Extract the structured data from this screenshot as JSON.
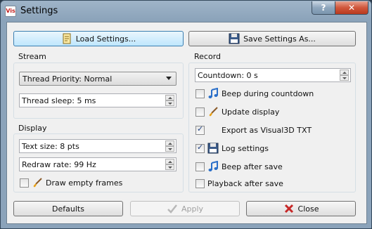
{
  "window": {
    "title": "Settings",
    "app_icon_text": "Vis"
  },
  "titlebar": {
    "help_label": "?",
    "close_label": "✕"
  },
  "toolbar": {
    "load_label": "Load Settings...",
    "save_as_label": "Save Settings As..."
  },
  "stream": {
    "heading": "Stream",
    "thread_priority": "Thread Priority: Normal",
    "thread_sleep": "Thread sleep: 5 ms"
  },
  "display": {
    "heading": "Display",
    "text_size": "Text size: 8 pts",
    "redraw_rate": "Redraw rate: 99 Hz",
    "draw_empty_frames": {
      "label": "Draw empty frames",
      "checked": false
    }
  },
  "record": {
    "heading": "Record",
    "countdown": "Countdown: 0 s",
    "options": [
      {
        "label": "Beep during countdown",
        "checked": false,
        "icon": "music-note-icon"
      },
      {
        "label": "Update display",
        "checked": false,
        "icon": "paintbrush-icon"
      },
      {
        "label": "Export as Visual3D TXT",
        "checked": true,
        "icon": ""
      },
      {
        "label": "Log settings",
        "checked": true,
        "icon": "floppy-disk-icon"
      },
      {
        "label": "Beep after save",
        "checked": false,
        "icon": "music-note-icon"
      },
      {
        "label": "Playback after save",
        "checked": false,
        "icon": ""
      }
    ]
  },
  "footer": {
    "defaults_label": "Defaults",
    "apply_label": "Apply",
    "close_label": "Close"
  },
  "colors": {
    "accent": "#3c7fb1",
    "close_red": "#c62828",
    "titlebar": "#8ba3ba"
  }
}
